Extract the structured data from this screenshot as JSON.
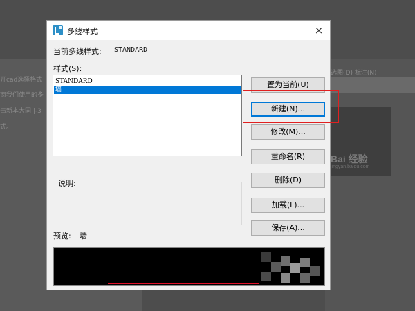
{
  "background": {
    "doc_lines": [
      "开cad选择格式",
      "窗我们使用的多",
      "击新本大同 |-3",
      "式。"
    ],
    "menu_text": "选图(D)   标注(N)",
    "watermark": "Bai 经验",
    "watermark_sub": "jingyan.baidu.com"
  },
  "dialog": {
    "title": "多线样式",
    "close_symbol": "×",
    "current_style_label": "当前多线样式:",
    "current_style_value": "STANDARD",
    "styles_label": "样式(S):",
    "styles": [
      {
        "name": "STANDARD",
        "selected": false
      },
      {
        "name": "墙",
        "selected": true
      }
    ],
    "description_label": "说明:",
    "preview_label": "预览:",
    "preview_value": "墙",
    "buttons": {
      "set_current": "置为当前(U)",
      "new": "新建(N)...",
      "modify": "修改(M)...",
      "rename": "重命名(R)",
      "delete": "删除(D)",
      "load": "加载(L)...",
      "save": "保存(A)..."
    }
  },
  "colors": {
    "selection": "#0078d7",
    "highlight_frame": "#e02020",
    "preview_line": "#e0102a"
  }
}
